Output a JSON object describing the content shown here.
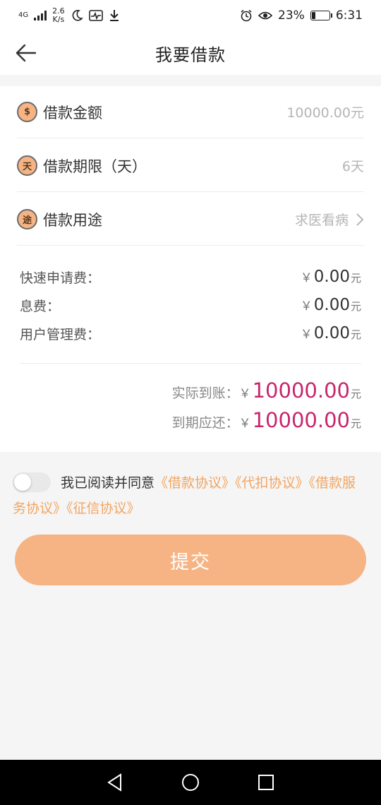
{
  "status_bar": {
    "network": "4G",
    "speed_value": "2.6",
    "speed_unit": "K/s",
    "battery": "23%",
    "time": "6:31",
    "battery_level": 0.23
  },
  "header": {
    "title": "我要借款"
  },
  "loan": {
    "rows": [
      {
        "badge": "$",
        "label": "借款金额",
        "value": "10000.00元"
      },
      {
        "badge": "天",
        "label": "借款期限（天）",
        "value": "6天"
      },
      {
        "badge": "途",
        "label": "借款用途",
        "value": "求医看病"
      }
    ],
    "fees": [
      {
        "label": "快速申请费：",
        "currency": "￥",
        "amount": "0.00",
        "unit": "元"
      },
      {
        "label": "息费：",
        "currency": "￥",
        "amount": "0.00",
        "unit": "元"
      },
      {
        "label": "用户管理费：",
        "currency": "￥",
        "amount": "0.00",
        "unit": "元"
      }
    ],
    "totals": [
      {
        "label": "实际到账：",
        "currency": "￥",
        "amount": "10000.00",
        "unit": "元"
      },
      {
        "label": "到期应还：",
        "currency": "￥",
        "amount": "10000.00",
        "unit": "元"
      }
    ]
  },
  "agreement": {
    "text": "我已阅读并同意",
    "links": [
      "《借款协议》",
      "《代扣协议》",
      "《借款服务协议》",
      "《征信协议》"
    ]
  },
  "submit": {
    "label": "提交"
  },
  "colors": {
    "accent": "#f6b485",
    "link": "#f2a561",
    "total_amount": "#c8266d"
  }
}
